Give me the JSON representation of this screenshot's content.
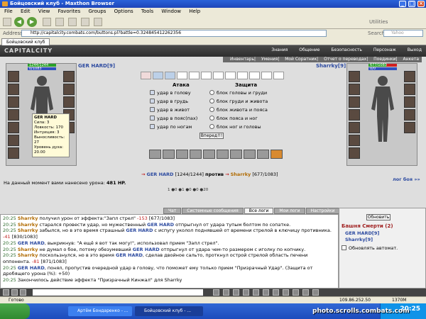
{
  "window": {
    "title": "Бойцовский клуб - Maxthon Browser"
  },
  "menu": [
    "File",
    "Edit",
    "View",
    "Favorites",
    "Groups",
    "Options",
    "Tools",
    "Window",
    "Help"
  ],
  "address": {
    "label": "Address",
    "url": "http://capitalcity.combats.com/buttons.pl?battle=0.324845412262356",
    "search_placeholder": "Yahoo",
    "search_label": "Search",
    "utilities": "Utilities"
  },
  "tab": {
    "label": "Бойцовский клуб"
  },
  "game": {
    "logo": "CAPITALCITY",
    "nav": [
      "Знания",
      "Общение",
      "Безопасность",
      "Персонаж",
      "Выход"
    ],
    "subnav": [
      "Инвентарь",
      "Умения",
      "Мой Соратник",
      "Отчет о переводах",
      "Поединки",
      "Анкета"
    ],
    "player1": {
      "name": "GER HARD",
      "level": "[9]",
      "hp": "1244/1244",
      "mana": "0/1083",
      "hp_text": "[1244/1244]",
      "hp_pct": 100
    },
    "player2": {
      "name": "Sharrky",
      "level": "[9]",
      "hp": "677/1083",
      "mana": "0/0",
      "hp_text": "[677/1083]",
      "hp_pct": 62.5
    },
    "tooltip": {
      "name": "GER HARD",
      "lines": [
        "Сила: 3",
        "Ловкость: 170",
        "Интуиция: 3",
        "Выносливость: 27"
      ],
      "spirit": "Уровень духа: 20.00"
    },
    "attack_title": "Атака",
    "defense_title": "Защита",
    "attack": [
      "удар в голову",
      "удар в грудь",
      "удар в живот",
      "удар в пояс(пах)",
      "удар по ногам"
    ],
    "defense": [
      "блок головы и груди",
      "блок груди и живота",
      "блок живота и пояса",
      "блок пояса и ног",
      "блок ног и головы"
    ],
    "forward_button": "Вперед!!!",
    "stats": "1  ●0  ●1  ●0  ●0  ●20",
    "versus": "против",
    "damage_label": "На данный момент вами нанесено урона:",
    "damage_value": "481 HP.",
    "log_link": "лог боя »»"
  },
  "log_tabs": [
    "Чат",
    "Системные сообщения",
    "Все логи",
    "Мои логи",
    "Настройки"
  ],
  "log": [
    {
      "time": "20:25",
      "who": "Sharrky",
      "rest": " получил урон от эффекта:\"Запл стрел\" ",
      "val": "-153",
      "hp": " [677/1083]"
    },
    {
      "time": "20:25",
      "who": "Sharrky",
      "rest": " старался провести удар, но мужественный ",
      "who2": "GER HARD",
      "rest2": " отпрыгнул от удара тупым болтом по сопатке."
    },
    {
      "time": "20:25",
      "who": "Sharrky",
      "rest": " забылся, но в это время страшный ",
      "who2": "GER HARD",
      "rest2": " с испугу уколол поднявшей от времени стрелой в ключицу противника. ",
      "val": "-41",
      "hp": " [830/1083]"
    },
    {
      "time": "20:25",
      "who": "GER HARD",
      "rest": ", выкрикнув: \"А ещё я вот так могу!\", использовал прием \"Запл стрел\"."
    },
    {
      "time": "20:25",
      "who": "Sharrky",
      "rest": " не думал о бое, потому обезумевший ",
      "who2": "GER HARD",
      "rest2": " отпрыгнул от удара чем-то размером с иголку по копчику."
    },
    {
      "time": "20:25",
      "who": "Sharrky",
      "rest": " поскользнулся, но в это время ",
      "who2": "GER HARD",
      "rest2": ", сделав двойное сальто, проткнул острой стрелой область печени оппонента. ",
      "val": "-81",
      "hp": " [871/1083]"
    },
    {
      "time": "20:25",
      "who": "GER HARD",
      "rest": ", понял, пропустив очередной удар в голову, что поможет ему только прием \"Призрачный Удар\". (Защита от дробящего урона (%): +50)"
    },
    {
      "time": "20:25",
      "who": "",
      "rest": "Закончилось действие эффекта \"Призрачный Кинжал\" для Sharrky"
    }
  ],
  "right_panel": {
    "refresh": "Обновить",
    "title": "Башня Смерти (2)",
    "players": [
      "GER HARD[9]",
      "Sharrky[9]"
    ],
    "auto_refresh": "Обновлять автомат."
  },
  "status": {
    "text": "Готово",
    "ip": "109.86.252.50",
    "size": "1370M"
  },
  "taskbar": {
    "items": [
      "Артём Бондаренко - ...",
      "Бойцовский клуб - ..."
    ],
    "clock": "20:25"
  },
  "watermark": "photo.scrolls.combats.com"
}
